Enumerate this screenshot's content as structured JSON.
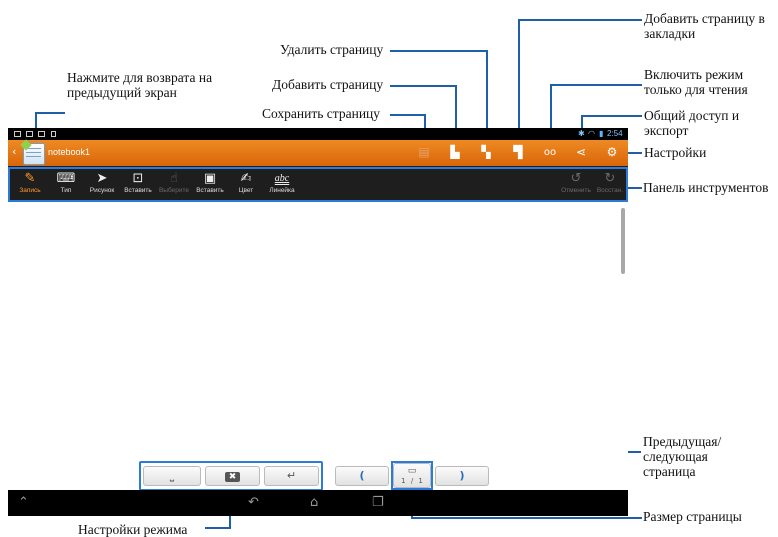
{
  "callouts": {
    "back": "Нажмите для возврата на предыдущий экран",
    "save": "Сохранить страницу",
    "add": "Добавить страницу",
    "delete": "Удалить страницу",
    "bookmark": "Добавить страницу в закладки",
    "read_only": "Включить режим только для чтения",
    "share": "Общий доступ и экспорт",
    "settings": "Настройки",
    "toolbar": "Панель инструментов",
    "prev_next": "Предыдущая/ следующая страница",
    "page_size": "Размер страницы",
    "mode_settings": "Настройки режима"
  },
  "status": {
    "time": "2:54"
  },
  "title": {
    "notebook": "notebook1"
  },
  "toolbar": {
    "items": [
      {
        "label": "Запись",
        "icon": "pen-icon"
      },
      {
        "label": "Тип",
        "icon": "keyboard-icon"
      },
      {
        "label": "Рисунок",
        "icon": "brush-icon"
      },
      {
        "label": "Вставить",
        "icon": "insert-icon"
      },
      {
        "label": "Выберите",
        "icon": "select-icon"
      },
      {
        "label": "Вставить",
        "icon": "paste-icon"
      },
      {
        "label": "Цвет",
        "icon": "color-icon"
      },
      {
        "label": "Линейка",
        "icon": "ruler-icon",
        "glyph": "abc"
      }
    ],
    "undo": "Отменить",
    "redo": "Восстан."
  },
  "page_indicator": {
    "current": "1",
    "separator": "/",
    "total": "1"
  },
  "colors": {
    "accent": "#e2730f",
    "callout_line": "#1f5fa8",
    "active_tool": "#ff9a2a"
  }
}
